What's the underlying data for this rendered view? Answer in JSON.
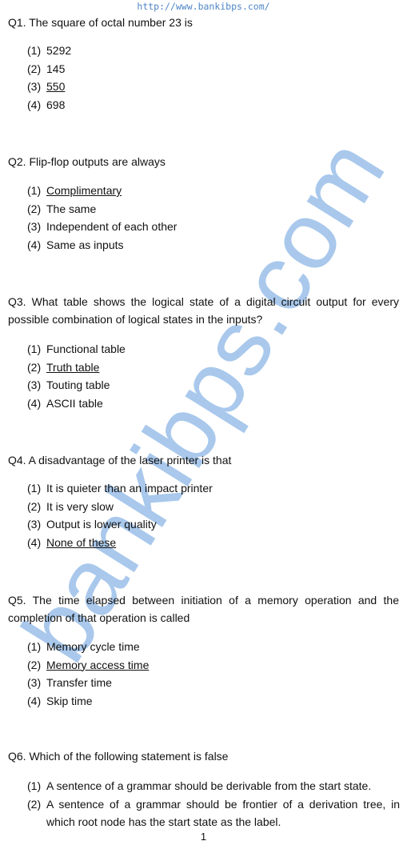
{
  "header": {
    "url": "http://www.bankibps.com/"
  },
  "watermark": {
    "text": "bankibps.com",
    "color": "#a9c8ec"
  },
  "questions": [
    {
      "label": "Q1. The square of octal number 23 is",
      "options": [
        {
          "num": "(1)",
          "text": "5292",
          "answer": false
        },
        {
          "num": "(2)",
          "text": "145",
          "answer": false
        },
        {
          "num": "(3)",
          "text": "550",
          "answer": true
        },
        {
          "num": "(4)",
          "text": "698",
          "answer": false
        }
      ]
    },
    {
      "label": "Q2. Flip-flop outputs are always",
      "options": [
        {
          "num": "(1)",
          "text": "Complimentary",
          "answer": true
        },
        {
          "num": "(2)",
          "text": "The same",
          "answer": false
        },
        {
          "num": "(3)",
          "text": "Independent of each other",
          "answer": false
        },
        {
          "num": "(4)",
          "text": "Same as inputs",
          "answer": false
        }
      ]
    },
    {
      "label": "Q3.  What table shows the logical state of a digital circuit output for every possible combination of logical states in the inputs?",
      "options": [
        {
          "num": "(1)",
          "text": "Functional table",
          "answer": false
        },
        {
          "num": "(2)",
          "text": "Truth table",
          "answer": true
        },
        {
          "num": "(3)",
          "text": "Touting table",
          "answer": false
        },
        {
          "num": "(4)",
          "text": "ASCII table",
          "answer": false
        }
      ]
    },
    {
      "label": "Q4. A disadvantage of the laser printer is that",
      "options": [
        {
          "num": "(1)",
          "text": "It is quieter than an impact printer",
          "answer": false
        },
        {
          "num": "(2)",
          "text": "It is very slow",
          "answer": false
        },
        {
          "num": "(3)",
          "text": "Output is lower quality",
          "answer": false
        },
        {
          "num": "(4)",
          "text": "None of these",
          "answer": true
        }
      ]
    },
    {
      "label": "Q5. The time elapsed between initiation of a memory operation and the completion of that operation is called",
      "options": [
        {
          "num": "(1)",
          "text": "Memory cycle time",
          "answer": false
        },
        {
          "num": "(2)",
          "text": "Memory access time",
          "answer": true
        },
        {
          "num": "(3)",
          "text": "Transfer time",
          "answer": false
        },
        {
          "num": "(4)",
          "text": "Skip time",
          "answer": false
        }
      ]
    },
    {
      "label": "Q6. Which of the following statement is false",
      "options": [
        {
          "num": "(1)",
          "text": "A sentence of a grammar should be derivable from the start state.",
          "answer": false
        },
        {
          "num": "(2)",
          "text": "A sentence of a grammar should be frontier of a derivation tree, in which root node has the start state as the label.",
          "answer": false
        }
      ]
    }
  ],
  "footer": {
    "page_number": "1"
  }
}
